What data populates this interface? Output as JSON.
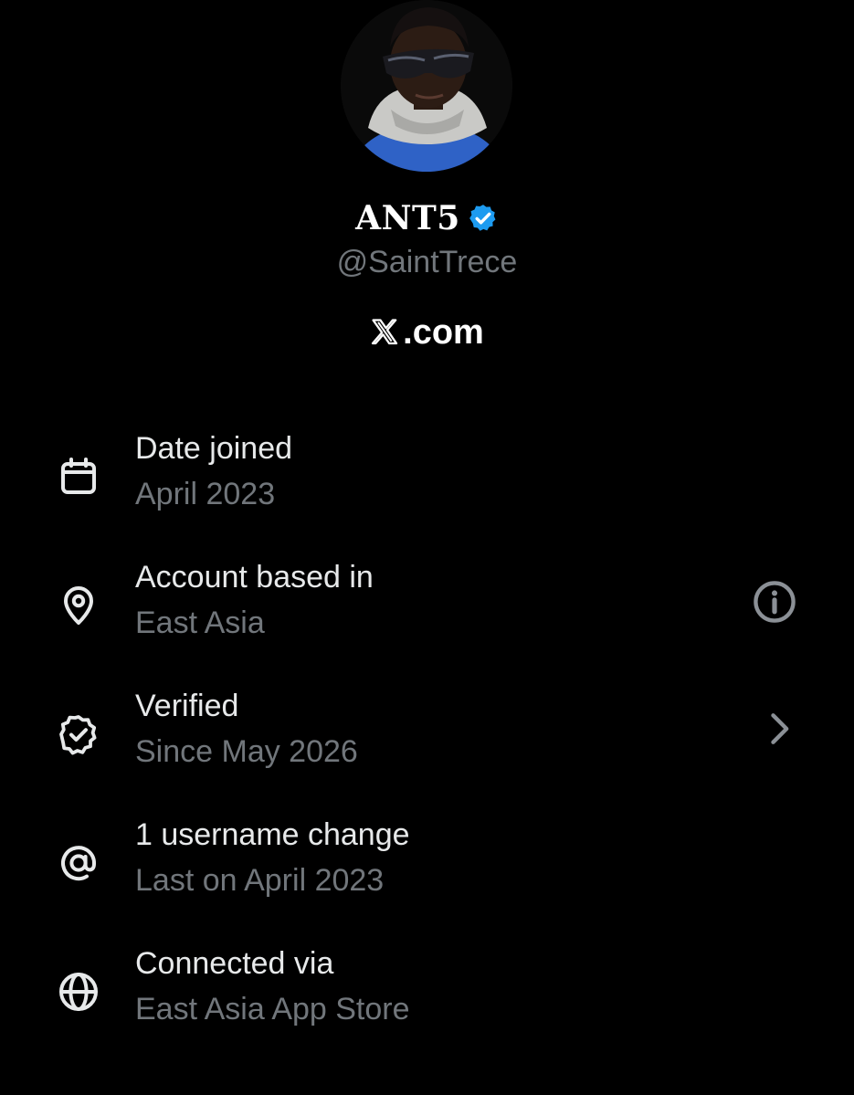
{
  "profile": {
    "display_name": "ANT5",
    "handle": "@SaintTrece",
    "site_suffix": ".com",
    "avatar_icon": "profile-photo",
    "badge_icon": "verified-badge-icon",
    "badge_color": "#1d9bf0"
  },
  "info": [
    {
      "icon": "calendar-icon",
      "title": "Date joined",
      "subtitle": "April 2023"
    },
    {
      "icon": "location-pin-icon",
      "title": "Account based in",
      "subtitle": "East Asia",
      "trailing": "info-icon"
    },
    {
      "icon": "verified-check-icon",
      "title": "Verified",
      "subtitle": "Since May 2026",
      "trailing": "chevron-right-icon"
    },
    {
      "icon": "at-sign-icon",
      "title": "1 username change",
      "subtitle": "Last on April 2023"
    },
    {
      "icon": "globe-icon",
      "title": "Connected via",
      "subtitle": "East Asia App Store"
    }
  ],
  "colors": {
    "background": "#000000",
    "primary_text": "#e7e9ea",
    "secondary_text": "#71767b",
    "accent": "#1d9bf0"
  }
}
